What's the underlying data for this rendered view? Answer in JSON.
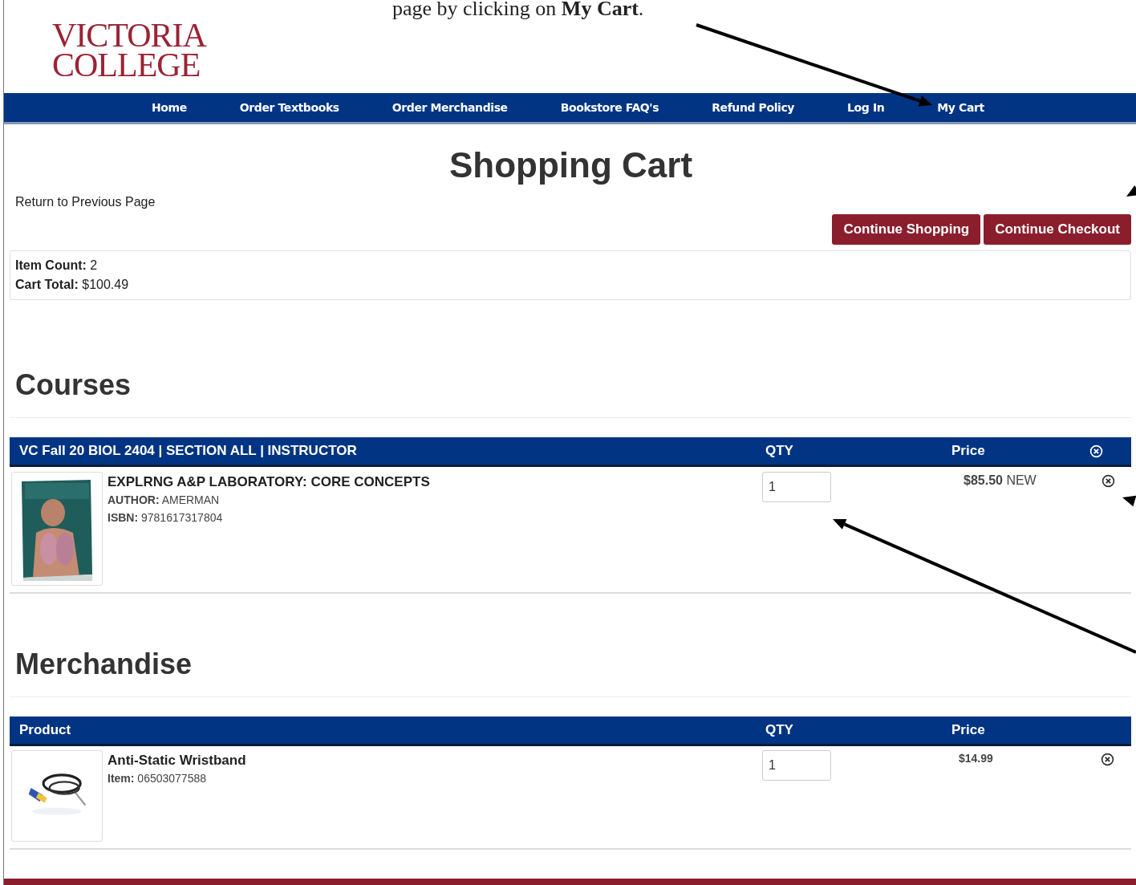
{
  "caption": "page by clicking on **My Cart**.",
  "logo": [
    "VICTORIA",
    "COLLEGE"
  ],
  "nav": [
    "Home",
    "Order Textbooks",
    "Order Merchandise",
    "Bookstore FAQ's",
    "Refund Policy",
    "Log In",
    "My Cart"
  ],
  "page_title": "Shopping Cart",
  "return_link": "Return to Previous Page",
  "buttons": [
    "Continue Shopping",
    "Continue Checkout"
  ],
  "summary": [
    "**Item Count:** 2",
    "**Cart Total:** $100.49"
  ],
  "sections": [
    {
      "heading": "Courses",
      "columns": [
        "VC Fall 20 BIOL 2404 | SECTION ALL | INSTRUCTOR",
        "QTY",
        "Price"
      ],
      "remove_all": true,
      "rows": [
        {
          "kind": "textbook",
          "title": "EXPLRNG A&P LABORATORY: CORE CONCEPTS",
          "details": [
            "**AUTHOR:** AMERMAN",
            "**ISBN:** 9781617317804"
          ],
          "qty": "1",
          "price": "**$85.50** NEW"
        }
      ]
    },
    {
      "heading": "Merchandise",
      "columns": [
        "Product",
        "QTY",
        "Price"
      ],
      "remove_all": false,
      "rows": [
        {
          "kind": "merchandise",
          "title": "Anti-Static Wristband",
          "details": [
            "**Item:** 06503077588"
          ],
          "qty": "1",
          "price": "**$14.99**"
        }
      ]
    }
  ]
}
